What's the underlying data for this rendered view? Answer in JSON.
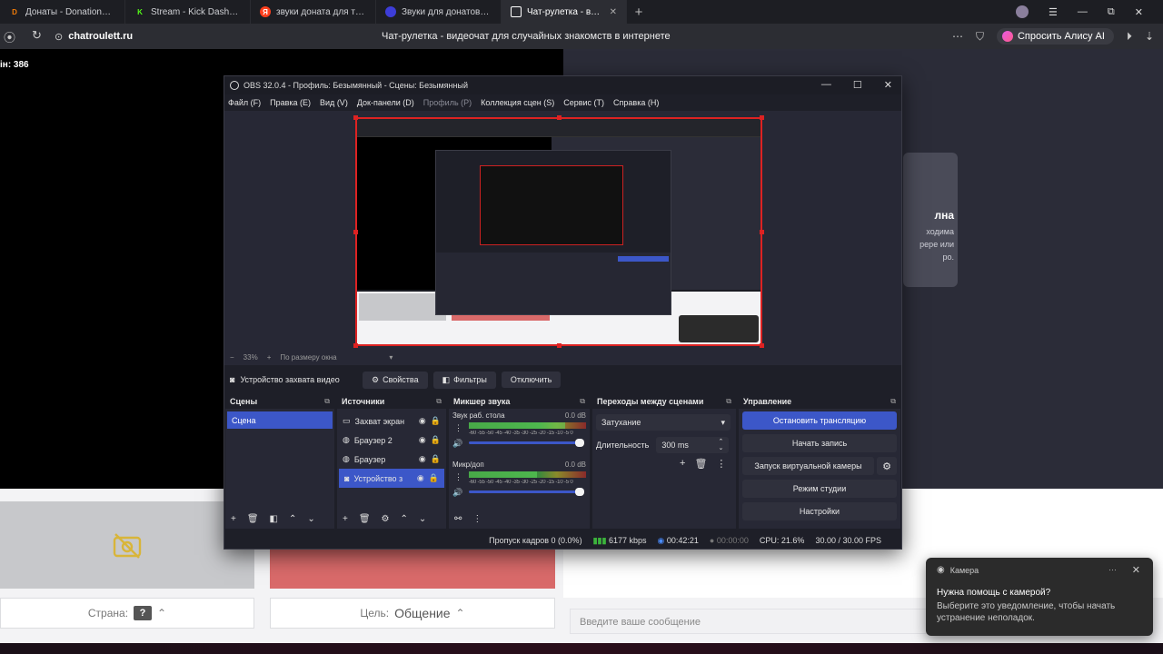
{
  "browser": {
    "tabs": [
      {
        "label": "Донаты - DonationAlerts",
        "icon": "donationalerts-icon",
        "color": "#f57d07"
      },
      {
        "label": "Stream - Kick Dashboard",
        "icon": "kick-icon",
        "color": "#53fc18"
      },
      {
        "label": "звуки доната для твича -",
        "icon": "yandex-icon",
        "color": "#fc3f1d"
      },
      {
        "label": "Звуки для донатов на стр",
        "icon": "globe-icon",
        "color": "#4a4aff"
      },
      {
        "label": "Чат-рулетка - видеоча",
        "icon": "chatroulette-icon",
        "color": "#ffffff"
      }
    ],
    "url": "chatroulett.ru",
    "page_title": "Чат-рулетка - видеочат для случайных знакомств в интернете",
    "alice_button": "Спросить Алису AI"
  },
  "page": {
    "counter_fragment": "ін: 386",
    "ghost_card_title": "лна",
    "ghost_card_lines": [
      "ходима",
      "рере или",
      "ро."
    ],
    "country_label": "Страна:",
    "country_value": "?",
    "goal_label": "Цель:",
    "goal_value": "Общение",
    "message_placeholder": "Введите ваше сообщение"
  },
  "notification": {
    "app": "Камера",
    "title": "Нужна помощь с камерой?",
    "body": "Выберите это уведомление, чтобы начать устранение неполадок."
  },
  "obs": {
    "title": "OBS 32.0.4 - Профиль: Безымянный - Сцены: Безымянный",
    "menu": [
      {
        "label": "Файл (F)",
        "enabled": true
      },
      {
        "label": "Правка (E)",
        "enabled": true
      },
      {
        "label": "Вид (V)",
        "enabled": true
      },
      {
        "label": "Док-панели (D)",
        "enabled": true
      },
      {
        "label": "Профиль (P)",
        "enabled": false
      },
      {
        "label": "Коллекция сцен (S)",
        "enabled": true
      },
      {
        "label": "Сервис (T)",
        "enabled": true
      },
      {
        "label": "Справка (H)",
        "enabled": true
      }
    ],
    "zoom": {
      "minus": "−",
      "percent": "33%",
      "plus": "+",
      "fit": "По размеру окна"
    },
    "source_toolbar": {
      "selected_source": "Устройство захвата видео",
      "properties": "Свойства",
      "filters": "Фильтры",
      "deactivate": "Отключить"
    },
    "docks": {
      "scenes": {
        "title": "Сцены",
        "items": [
          "Сцена"
        ]
      },
      "sources": {
        "title": "Источники",
        "items": [
          {
            "name": "Захват экран",
            "icon": "monitor-icon",
            "selected": false
          },
          {
            "name": "Браузер 2",
            "icon": "globe-icon",
            "selected": false
          },
          {
            "name": "Браузер",
            "icon": "globe-icon",
            "selected": false
          },
          {
            "name": "Устройство з",
            "icon": "camera-icon",
            "selected": true
          }
        ]
      },
      "mixer": {
        "title": "Микшер звука",
        "channels": [
          {
            "name": "Звук раб. стола",
            "db": "0.0 dB",
            "level": 0.82
          },
          {
            "name": "Микр/доп",
            "db": "0.0 dB",
            "level": 0.58
          }
        ],
        "ticks": "-60 -55 -50 -45 -40 -35 -30 -25 -20 -15 -10 -5 0"
      },
      "transitions": {
        "title": "Переходы между сценами",
        "selected": "Затухание",
        "duration_label": "Длительность",
        "duration_value": "300 ms"
      },
      "controls": {
        "title": "Управление",
        "stop_stream": "Остановить трансляцию",
        "start_recording": "Начать запись",
        "virtual_camera": "Запуск виртуальной камеры",
        "studio_mode": "Режим студии",
        "settings": "Настройки"
      }
    },
    "status": {
      "dropped_frames": "Пропуск кадров 0 (0.0%)",
      "bitrate": "6177 kbps",
      "stream_time": "00:42:21",
      "record_time": "00:00:00",
      "cpu": "CPU: 21.6%",
      "fps": "30.00 / 30.00 FPS"
    }
  }
}
